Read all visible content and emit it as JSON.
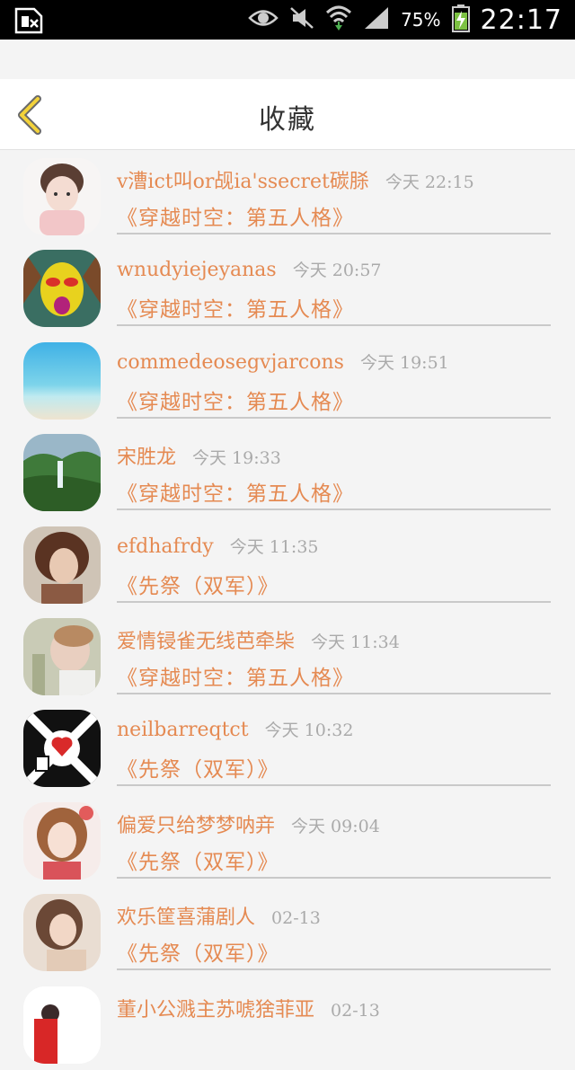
{
  "status_bar": {
    "battery": "75%",
    "time": "22:17"
  },
  "header": {
    "title": "收藏"
  },
  "favorites": [
    {
      "name": "v漕ict叫or觇ia'ssecret碳脎",
      "time": "今天 22:15",
      "book": "《穿越时空：第五人格》"
    },
    {
      "name": "wnudyiejeyanas",
      "time": "今天 20:57",
      "book": "《穿越时空：第五人格》"
    },
    {
      "name": "commedeosegvjarcons",
      "time": "今天 19:51",
      "book": "《穿越时空：第五人格》"
    },
    {
      "name": "宋胜龙",
      "time": "今天 19:33",
      "book": "《穿越时空：第五人格》"
    },
    {
      "name": "efdhafrdy",
      "time": "今天 11:35",
      "book": "《先祭（双军）》"
    },
    {
      "name": "爱情锓雀无线芭牵枈",
      "time": "今天 11:34",
      "book": "《穿越时空：第五人格》"
    },
    {
      "name": "neilbarreqtct",
      "time": "今天 10:32",
      "book": "《先祭（双军）》"
    },
    {
      "name": "偏爱只给梦梦呐竎",
      "time": "今天 09:04",
      "book": "《先祭（双军）》"
    },
    {
      "name": "欢乐筐喜蒲剧人",
      "time": "02-13",
      "book": "《先祭（双军）》"
    },
    {
      "name": "董小公溅主苏唬猞菲亚",
      "time": "02-13",
      "book": ""
    }
  ]
}
